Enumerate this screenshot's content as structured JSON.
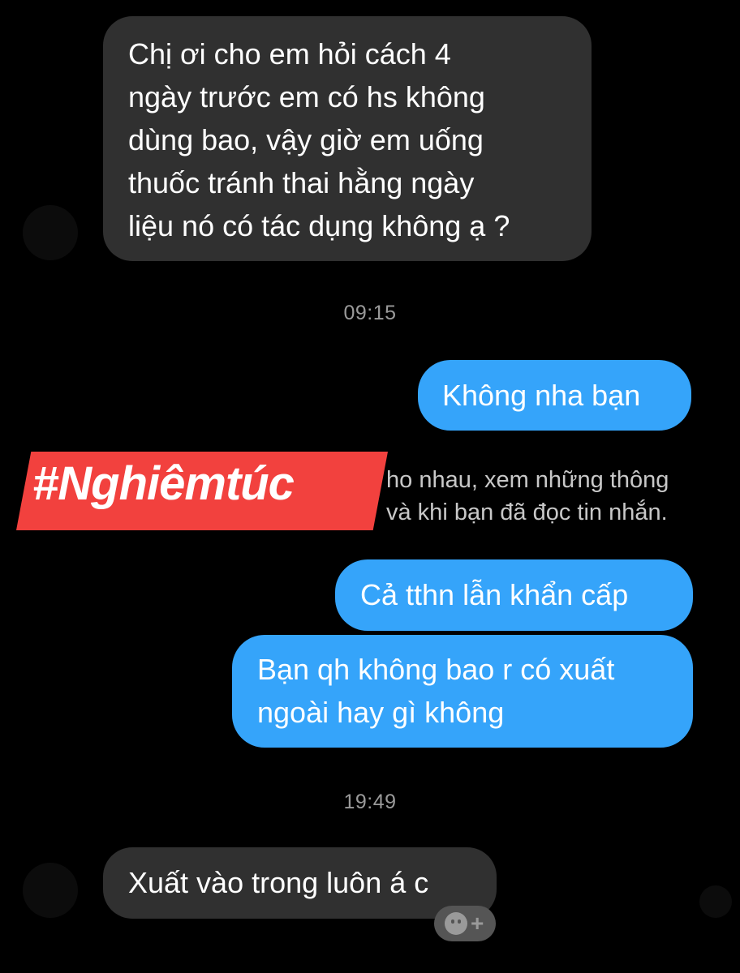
{
  "messages": [
    {
      "text": "Chị ơi cho em hỏi cách 4\nngày trước em có hs không\ndùng bao, vậy giờ em uống\nthuốc tránh thai hằng ngày\nliệu nó có tác dụng không ạ ?"
    },
    {
      "text": "Không nha bạn"
    },
    {
      "text": "Cả tthn lẫn khẩn cấp"
    },
    {
      "text": "Bạn qh không bao r có xuất\nngoài hay gì không"
    },
    {
      "text": "Xuất vào trong luôn á c"
    }
  ],
  "timestamps": [
    "09:15",
    "19:49"
  ],
  "notice": {
    "line1": "ho nhau, xem những thông",
    "line2": "và khi bạn đã đọc tin nhắn."
  },
  "overlay_tag": "#Nghiêmtúc",
  "reaction_button": {
    "icon": "smiley-plus-icon",
    "plus": "+"
  },
  "colors": {
    "background": "#000000",
    "incoming_bubble": "#303030",
    "outgoing_bubble": "#35a4fa",
    "tag_banner": "#f2413e",
    "timestamp_text": "#9a9a9a"
  }
}
